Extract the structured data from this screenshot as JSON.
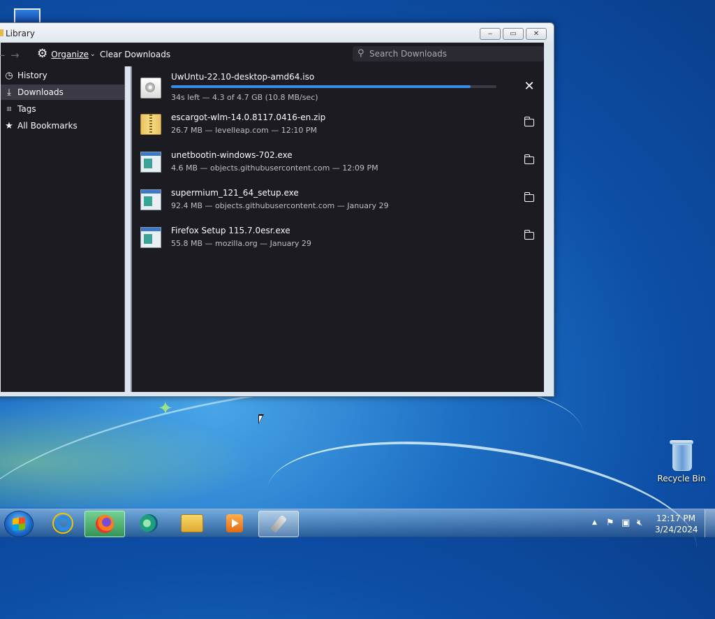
{
  "window": {
    "title": "Library",
    "minimize": "‒",
    "maximize": "▭",
    "close": "✕"
  },
  "toolbar": {
    "back": "←",
    "forward": "→",
    "organize_label": "Organize",
    "clear_downloads_label": "Clear Downloads",
    "search_placeholder": "Search Downloads",
    "search_value": ""
  },
  "sidebar": {
    "items": [
      {
        "label": "History",
        "icon": "clock-icon",
        "selected": false
      },
      {
        "label": "Downloads",
        "icon": "download-icon",
        "selected": true
      },
      {
        "label": "Tags",
        "icon": "tag-icon",
        "selected": false
      },
      {
        "label": "All Bookmarks",
        "icon": "star-icon",
        "selected": false
      }
    ]
  },
  "downloads": [
    {
      "name": "UwUntu-22.10-desktop-amd64.iso",
      "meta": "34s left — 4.3 of 4.7 GB (10.8 MB/sec)",
      "in_progress": true,
      "progress_fraction": 0.92,
      "file_type": "iso",
      "action": "cancel"
    },
    {
      "name": "escargot-wlm-14.0.8117.0416-en.zip",
      "meta": "26.7 MB — levelleap.com — 12:10 PM",
      "in_progress": false,
      "file_type": "zip",
      "action": "show-in-folder"
    },
    {
      "name": "unetbootin-windows-702.exe",
      "meta": "4.6 MB — objects.githubusercontent.com — 12:09 PM",
      "in_progress": false,
      "file_type": "exe",
      "action": "show-in-folder"
    },
    {
      "name": "supermium_121_64_setup.exe",
      "meta": "92.4 MB — objects.githubusercontent.com — January 29",
      "in_progress": false,
      "file_type": "exe",
      "action": "show-in-folder"
    },
    {
      "name": "Firefox Setup 115.7.0esr.exe",
      "meta": "55.8 MB — mozilla.org — January 29",
      "in_progress": false,
      "file_type": "exe",
      "action": "show-in-folder"
    }
  ],
  "desktop": {
    "recycle_bin_label": "Recycle Bin"
  },
  "taskbar": {
    "items": [
      {
        "name": "internet-explorer",
        "state": "pinned"
      },
      {
        "name": "firefox",
        "state": "active"
      },
      {
        "name": "edge",
        "state": "pinned"
      },
      {
        "name": "file-explorer",
        "state": "pinned"
      },
      {
        "name": "media-player",
        "state": "pinned"
      },
      {
        "name": "rocket-app",
        "state": "open"
      }
    ],
    "clock_time": "12:17 PM",
    "clock_date": "3/24/2024"
  },
  "colors": {
    "accent": "#3b8ce8",
    "panel_bg": "#1c1b22",
    "text": "#fbfbfe"
  }
}
